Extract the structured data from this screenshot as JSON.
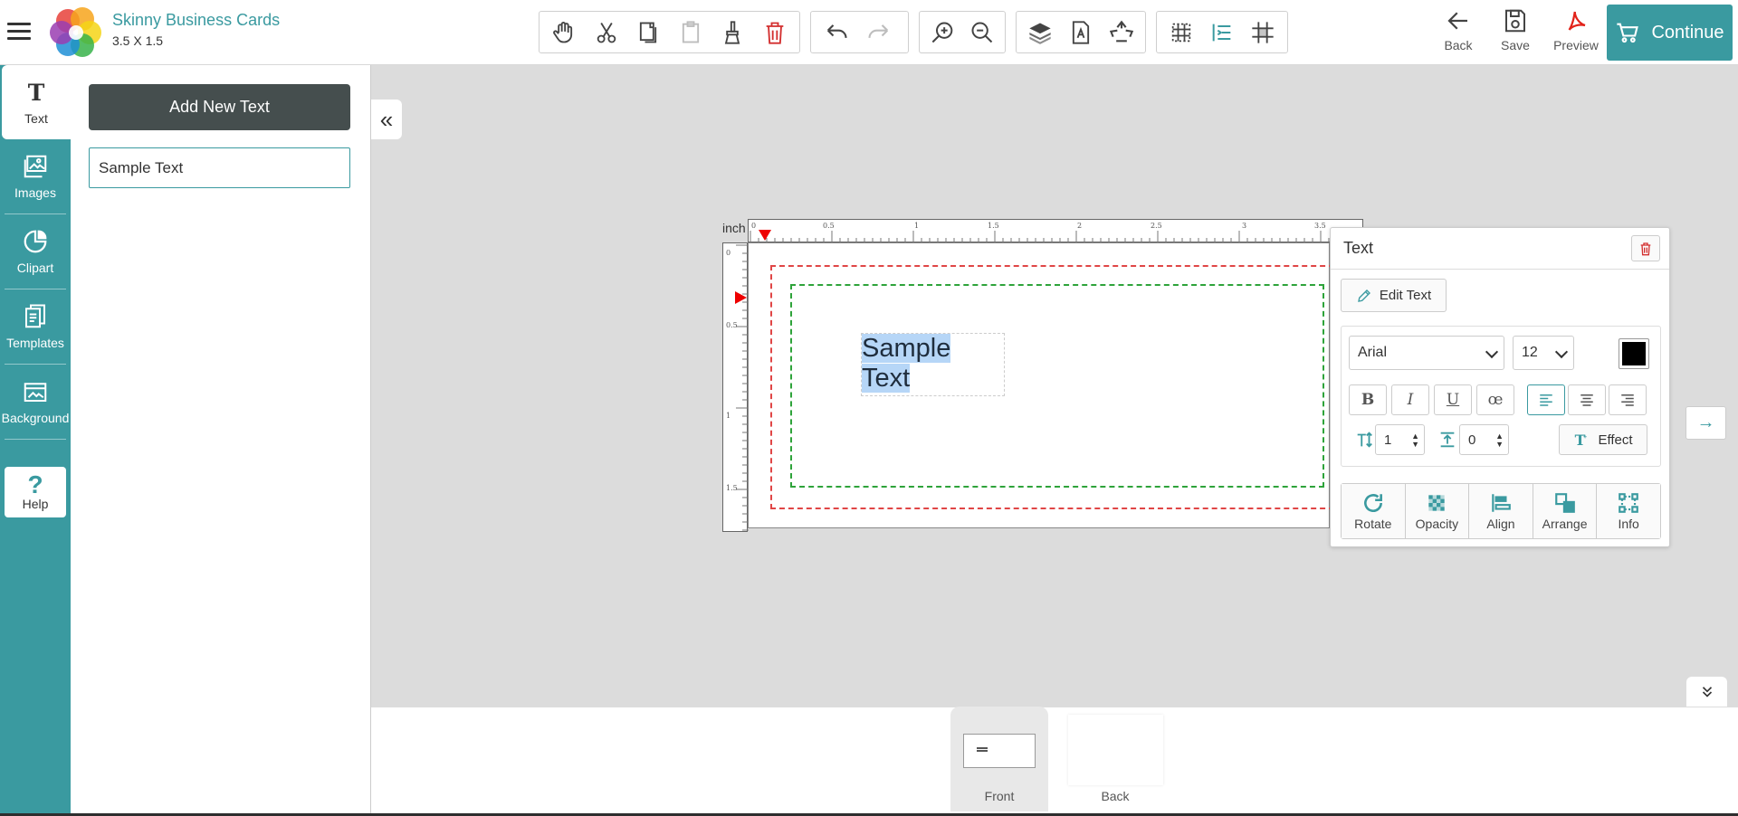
{
  "app": {
    "product_name": "Skinny Business Cards",
    "product_size": "3.5 X 1.5"
  },
  "header": {
    "back_label": "Back",
    "save_label": "Save",
    "preview_label": "Preview",
    "continue_label": "Continue"
  },
  "toolbar": {
    "icons": [
      "hand-icon",
      "cut-icon",
      "copy-icon",
      "paste-icon",
      "paint-brush-icon",
      "trash-icon",
      "undo-icon",
      "redo-icon",
      "zoom-in-icon",
      "zoom-out-icon",
      "layers-icon",
      "text-page-icon",
      "recycle-icon",
      "grid-icon",
      "indent-icon",
      "guides-icon"
    ]
  },
  "leftnav": {
    "items": [
      {
        "label": "Text",
        "icon": "text-icon"
      },
      {
        "label": "Images",
        "icon": "images-icon"
      },
      {
        "label": "Clipart",
        "icon": "clipart-icon"
      },
      {
        "label": "Templates",
        "icon": "templates-icon"
      },
      {
        "label": "Background",
        "icon": "background-icon"
      }
    ],
    "help_label": "Help"
  },
  "textpanel": {
    "add_button": "Add New Text",
    "text_value": "Sample Text"
  },
  "canvas": {
    "unit_label": "inch",
    "ruler_top_ticks": [
      "0",
      "0.5",
      "1",
      "1.5",
      "2",
      "2.5",
      "3",
      "3.5"
    ],
    "ruler_left_ticks": [
      "0",
      "0.5",
      "1",
      "1.5"
    ],
    "text_line1": "Sample",
    "text_line2": "Text"
  },
  "props": {
    "title": "Text",
    "edit_label": "Edit Text",
    "font": "Arial",
    "font_size": "12",
    "text_color": "#000000",
    "line_height": "1",
    "letter_spacing": "0",
    "effect_label": "Effect",
    "format_buttons": {
      "bold": "B",
      "italic": "I",
      "underline": "U",
      "ligature": "œ"
    },
    "tools": [
      {
        "label": "Rotate"
      },
      {
        "label": "Opacity"
      },
      {
        "label": "Align"
      },
      {
        "label": "Arrange"
      },
      {
        "label": "Info"
      }
    ]
  },
  "pages": {
    "front_label": "Front",
    "back_label": "Back"
  },
  "colors": {
    "accent": "#3a9aa0",
    "bleed_line": "#e04646",
    "safe_line": "#2ea33a",
    "selection": "#b6d6f7",
    "dark_button": "#454e4e"
  }
}
